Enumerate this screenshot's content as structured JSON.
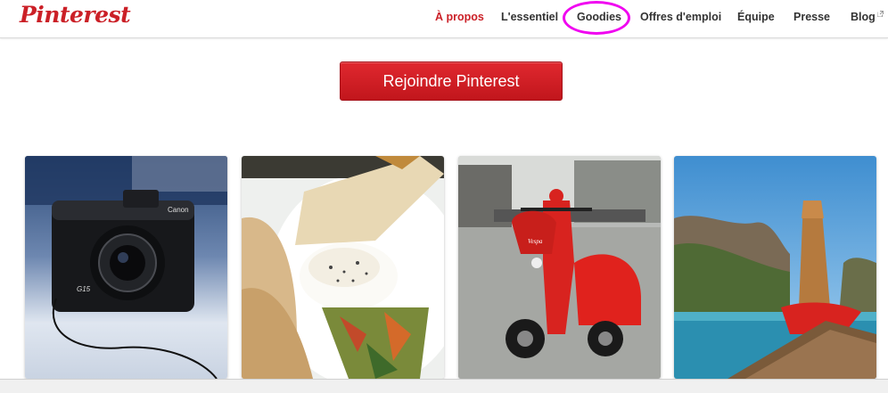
{
  "header": {
    "logo_text": "Pinterest",
    "nav": [
      {
        "label": "À propos",
        "active": true
      },
      {
        "label": "L'essentiel",
        "active": false
      },
      {
        "label": "Goodies",
        "active": false
      },
      {
        "label": "Offres d'emploi",
        "active": false
      },
      {
        "label": "Équipe",
        "active": false
      },
      {
        "label": "Presse",
        "active": false
      },
      {
        "label": "Blog",
        "active": false,
        "icon": "external-link-icon"
      }
    ]
  },
  "cta": {
    "label": "Rejoindre Pinterest"
  },
  "pins": [
    {
      "subject": "camera",
      "brand_text": "Canon",
      "model_text": "G15"
    },
    {
      "subject": "food"
    },
    {
      "subject": "scooter",
      "badge_text": "Vespa"
    },
    {
      "subject": "longtail-boat"
    }
  ],
  "colors": {
    "brand_red": "#cb2027",
    "nav_text": "#333333",
    "highlight": "#f000f0"
  }
}
